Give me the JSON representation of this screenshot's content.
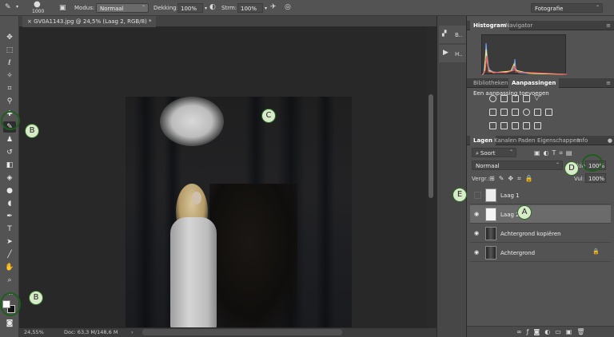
{
  "optbar": {
    "brush_size": "1000",
    "mode_label": "Modus:",
    "mode_value": "Normaal",
    "opacity_label": "Dekking:",
    "opacity_value": "100%",
    "flow_label": "Strm:",
    "flow_value": "100%",
    "workspace": "Fotografie"
  },
  "document": {
    "tab_title": "GV0A1143.jpg @ 24,5% (Laag 2, RGB/8) *",
    "zoom": "24,55%",
    "doc_info": "Doc: 63,3 M/148,6 M"
  },
  "dock": {
    "item1": "B..",
    "item2": "H.."
  },
  "panels": {
    "top_tabs": [
      "Histogram",
      "Navigator"
    ],
    "mid_tabs": [
      "Bibliotheken",
      "Aanpassingen"
    ],
    "adjust_title": "Een aanpassing toevoegen",
    "layer_tabs": [
      "Lagen",
      "Kanalen",
      "Paden",
      "Eigenschappen",
      "Info"
    ],
    "kind_filter": "Soort",
    "blend_mode": "Normaal",
    "opacity_label": "Dekking:",
    "opacity_value": "100%",
    "lock_label": "Vergr.:",
    "fill_label": "Vul:",
    "fill_value": "100%",
    "layers": [
      {
        "name": "Laag 1",
        "visible": false,
        "selected": false
      },
      {
        "name": "Laag 2",
        "visible": true,
        "selected": true
      },
      {
        "name": "Achtergrond kopiëren",
        "visible": true,
        "selected": false
      },
      {
        "name": "Achtergrond",
        "visible": true,
        "selected": false,
        "locked": true
      }
    ]
  },
  "markers": {
    "a": "A",
    "b1": "B",
    "b2": "B",
    "c": "C",
    "d": "D",
    "e": "E"
  },
  "colors": {
    "marker_fill": "#d8ebc8",
    "marker_ring": "#1e5e1c",
    "ui_panel": "#535353",
    "canvas_bg": "#282828"
  }
}
